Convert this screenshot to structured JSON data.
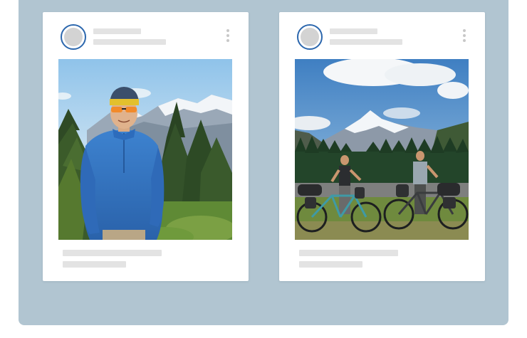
{
  "feed": {
    "posts": [
      {
        "photo_icon": "photo-hiker-portrait",
        "menu_icon": "kebab-menu-icon",
        "avatar_ring_color": "#2c67ad"
      },
      {
        "photo_icon": "photo-cyclists-mountain",
        "menu_icon": "kebab-menu-icon",
        "avatar_ring_color": "#2c67ad"
      }
    ]
  },
  "colors": {
    "backdrop": "#b1c5d1",
    "card": "#ffffff",
    "skeleton": "#e3e3e3",
    "avatar_ring": "#2c67ad"
  }
}
